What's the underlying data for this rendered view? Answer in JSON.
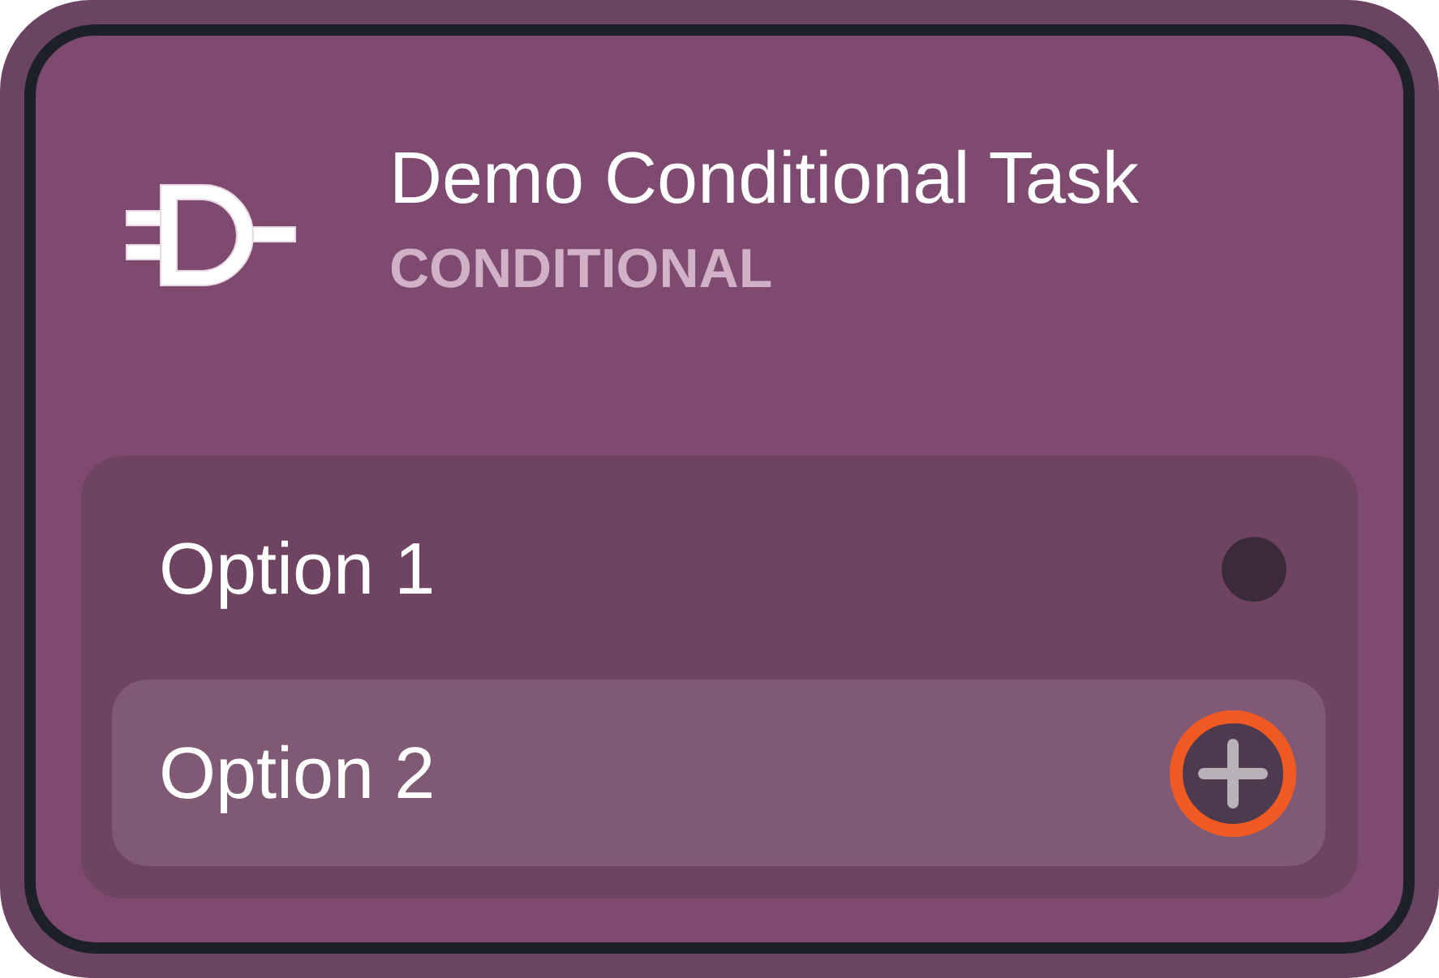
{
  "task": {
    "title": "Demo Conditional Task",
    "type": "CONDITIONAL"
  },
  "options": [
    {
      "label": "Option 1",
      "selected": false
    },
    {
      "label": "Option 2",
      "selected": true
    }
  ]
}
